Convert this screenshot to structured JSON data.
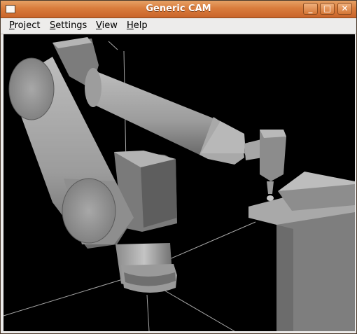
{
  "window": {
    "title": "Generic CAM",
    "controls": {
      "minimize": "_",
      "maximize": "□",
      "close": "✕"
    }
  },
  "menu": {
    "items": [
      {
        "first": "P",
        "rest": "roject"
      },
      {
        "first": "S",
        "rest": "ettings"
      },
      {
        "first": "V",
        "rest": "iew"
      },
      {
        "first": "H",
        "rest": "elp"
      }
    ]
  },
  "viewport": {
    "scene": "robot-arm-3d",
    "background_color": "#000000"
  }
}
